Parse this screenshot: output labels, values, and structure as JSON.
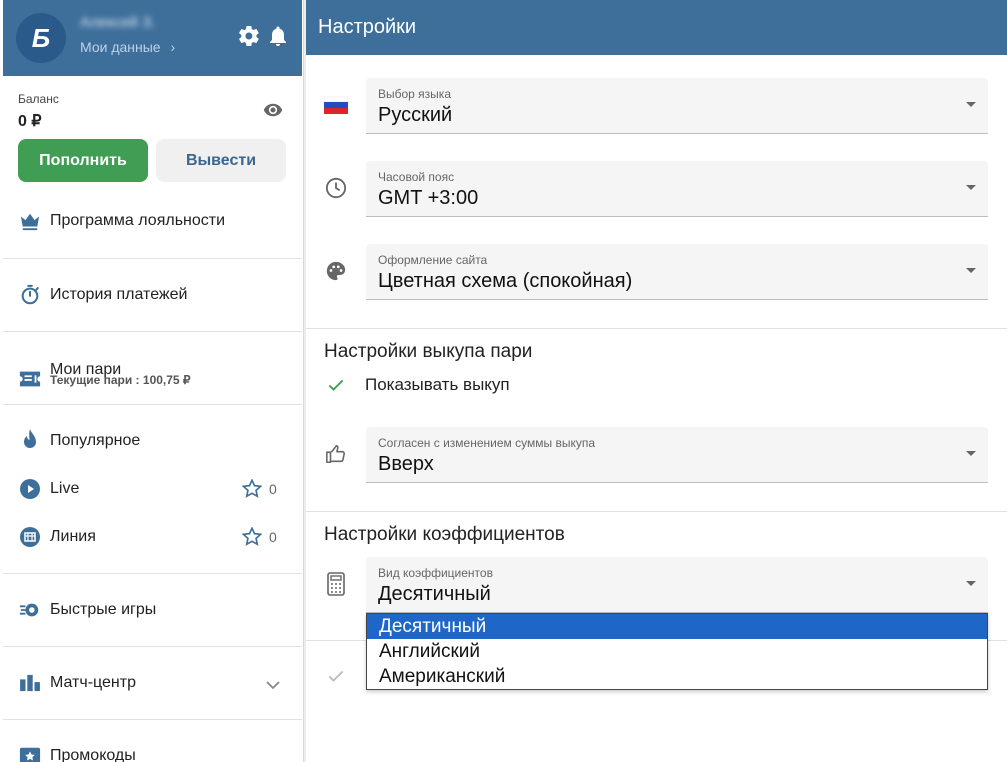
{
  "profile": {
    "avatar_letter": "Б",
    "user_name": "Алексей З.",
    "my_data_link": "Мои данные",
    "my_data_chevron": "›"
  },
  "balance": {
    "label": "Баланс",
    "value": "0 ₽",
    "deposit_label": "Пополнить",
    "withdraw_label": "Вывести"
  },
  "sidebar": {
    "items": [
      {
        "label": "Программа лояльности",
        "icon": "crown-icon"
      },
      {
        "label": "История платежей",
        "icon": "stopwatch-icon"
      },
      {
        "label": "Мои пари",
        "icon": "ticket-icon",
        "sub": "Текущие пари : 100,75 ₽"
      },
      {
        "label": "Популярное",
        "icon": "flame-icon"
      },
      {
        "label": "Live",
        "icon": "play-icon",
        "favorites": "0"
      },
      {
        "label": "Линия",
        "icon": "calendar-icon",
        "favorites": "0"
      },
      {
        "label": "Быстрые игры",
        "icon": "fast-games-icon"
      },
      {
        "label": "Матч-центр",
        "icon": "stats-icon"
      },
      {
        "label": "Промокоды",
        "icon": "promo-icon"
      }
    ]
  },
  "header": {
    "title": "Настройки"
  },
  "settings": {
    "language": {
      "label": "Выбор языка",
      "value": "Русский"
    },
    "timezone": {
      "label": "Часовой пояс",
      "value": "GMT +3:00"
    },
    "theme": {
      "label": "Оформление сайта",
      "value": "Цветная схема (спокойная)"
    },
    "buyout_section_title": "Настройки выкупа пари",
    "show_buyout_label": "Показывать выкуп",
    "buyout_change": {
      "label": "Согласен с изменением суммы выкупа",
      "value": "Вверх"
    },
    "odds_section_title": "Настройки коэффициентов",
    "odds_format": {
      "label": "Вид коэффициентов",
      "value": "Десятичный"
    },
    "odds_options": [
      "Десятичный",
      "Английский",
      "Американский"
    ]
  },
  "colors": {
    "header_blue": "#3e6f9b",
    "deposit_green": "#3f9e53",
    "dropdown_selected": "#1f66c9",
    "check_green": "#3f9e53"
  }
}
